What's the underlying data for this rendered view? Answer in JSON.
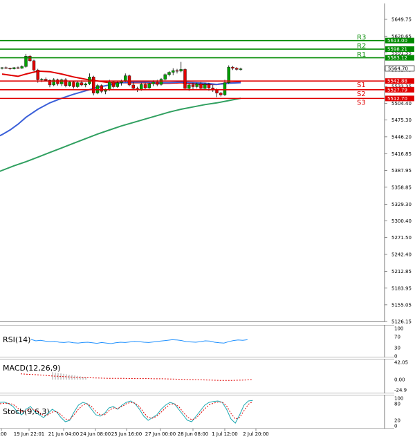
{
  "chart_data": {
    "type": "candlestick",
    "price_axis": {
      "ticks": [
        "5649.75",
        "5620.65",
        "5591.55",
        "5562.45",
        "5533.35",
        "5504.40",
        "5475.30",
        "5446.20",
        "5416.85",
        "5387.95",
        "5358.85",
        "5329.30",
        "5300.40",
        "5271.50",
        "5242.40",
        "5212.85",
        "5183.95",
        "5155.05",
        "5126.15"
      ],
      "range": [
        5126.15,
        5649.75
      ]
    },
    "time_axis": [
      "2:00",
      "19 Jun 22:01",
      "21 Jun 04:00",
      "24 Jun 08:00",
      "25 Jun 16:00",
      "27 Jun 00:00",
      "28 Jun 08:00",
      "1 Jul 12:00",
      "2 Jul 20:00"
    ],
    "levels": [
      {
        "name": "R3",
        "value": 5613.0,
        "label": "5613.00",
        "color": "#008a00"
      },
      {
        "name": "R2",
        "value": 5598.21,
        "label": "5598.21",
        "color": "#008a00"
      },
      {
        "name": "R1",
        "value": 5583.12,
        "label": "5583.12",
        "color": "#008a00"
      },
      {
        "name": "S1",
        "value": 5542.88,
        "label": "5542.88",
        "color": "#e00000"
      },
      {
        "name": "S2",
        "value": 5527.79,
        "label": "5527.79",
        "color": "#e00000"
      },
      {
        "name": "S3",
        "value": 5512.7,
        "label": "5512.70",
        "color": "#e00000"
      }
    ],
    "current_price": {
      "value": 5564.7,
      "label": "5564.70"
    },
    "candles": [
      [
        5565,
        5567,
        5563,
        5566
      ],
      [
        5566,
        5568,
        5564,
        5565
      ],
      [
        5565,
        5566,
        5562,
        5564
      ],
      [
        5564,
        5567,
        5563,
        5566
      ],
      [
        5566,
        5568,
        5564,
        5565
      ],
      [
        5565,
        5570,
        5564,
        5568
      ],
      [
        5568,
        5590,
        5566,
        5586
      ],
      [
        5586,
        5588,
        5576,
        5578
      ],
      [
        5578,
        5580,
        5560,
        5562
      ],
      [
        5562,
        5564,
        5540,
        5545
      ],
      [
        5545,
        5548,
        5541,
        5546
      ],
      [
        5546,
        5549,
        5542,
        5544
      ],
      [
        5544,
        5546,
        5532,
        5536
      ],
      [
        5536,
        5548,
        5534,
        5545
      ],
      [
        5545,
        5547,
        5535,
        5538
      ],
      [
        5538,
        5547,
        5534,
        5545
      ],
      [
        5545,
        5548,
        5532,
        5535
      ],
      [
        5535,
        5543,
        5533,
        5541
      ],
      [
        5541,
        5543,
        5530,
        5533
      ],
      [
        5533,
        5543,
        5531,
        5540
      ],
      [
        5540,
        5544,
        5534,
        5536
      ],
      [
        5536,
        5540,
        5532,
        5538
      ],
      [
        5538,
        5556,
        5536,
        5550
      ],
      [
        5550,
        5552,
        5518,
        5522
      ],
      [
        5522,
        5538,
        5520,
        5535
      ],
      [
        5535,
        5537,
        5522,
        5525
      ],
      [
        5525,
        5530,
        5520,
        5528
      ],
      [
        5528,
        5545,
        5526,
        5541
      ],
      [
        5541,
        5543,
        5530,
        5533
      ],
      [
        5533,
        5543,
        5531,
        5540
      ],
      [
        5540,
        5545,
        5535,
        5543
      ],
      [
        5543,
        5556,
        5541,
        5552
      ],
      [
        5552,
        5554,
        5534,
        5536
      ],
      [
        5536,
        5541,
        5527,
        5530
      ],
      [
        5530,
        5533,
        5524,
        5528
      ],
      [
        5528,
        5540,
        5526,
        5537
      ],
      [
        5537,
        5540,
        5527,
        5531
      ],
      [
        5531,
        5540,
        5529,
        5538
      ],
      [
        5538,
        5544,
        5534,
        5541
      ],
      [
        5541,
        5545,
        5534,
        5537
      ],
      [
        5537,
        5548,
        5535,
        5546
      ],
      [
        5546,
        5556,
        5544,
        5554
      ],
      [
        5554,
        5560,
        5551,
        5558
      ],
      [
        5558,
        5565,
        5553,
        5561
      ],
      [
        5561,
        5564,
        5556,
        5560
      ],
      [
        5560,
        5576,
        5558,
        5563
      ],
      [
        5563,
        5565,
        5528,
        5530
      ],
      [
        5530,
        5538,
        5526,
        5536
      ],
      [
        5536,
        5540,
        5528,
        5533
      ],
      [
        5533,
        5540,
        5530,
        5538
      ],
      [
        5538,
        5541,
        5527,
        5530
      ],
      [
        5530,
        5540,
        5528,
        5537
      ],
      [
        5537,
        5540,
        5526,
        5531
      ],
      [
        5531,
        5536,
        5524,
        5527
      ],
      [
        5527,
        5530,
        5515,
        5522
      ],
      [
        5522,
        5524,
        5516,
        5519
      ],
      [
        5519,
        5545,
        5517,
        5540
      ],
      [
        5540,
        5570,
        5538,
        5567
      ],
      [
        5567,
        5569,
        5562,
        5565
      ],
      [
        5565,
        5567,
        5561,
        5563
      ],
      [
        5563,
        5566,
        5561,
        5564
      ]
    ],
    "moving_averages": [
      {
        "color": "#e00000",
        "points": [
          [
            0,
            5555
          ],
          [
            2,
            5553
          ],
          [
            4,
            5551
          ],
          [
            6,
            5555
          ],
          [
            9,
            5560
          ],
          [
            12,
            5559
          ],
          [
            15,
            5555
          ],
          [
            18,
            5550
          ],
          [
            21,
            5546
          ],
          [
            24,
            5543
          ],
          [
            27,
            5540
          ],
          [
            30,
            5540
          ],
          [
            33,
            5540
          ],
          [
            36,
            5540
          ],
          [
            39,
            5539
          ],
          [
            42,
            5539
          ],
          [
            45,
            5540
          ],
          [
            48,
            5538
          ],
          [
            51,
            5537
          ],
          [
            54,
            5537
          ],
          [
            57,
            5540
          ],
          [
            60,
            5541
          ]
        ]
      },
      {
        "color": "#3a5fd9",
        "points": [
          [
            -3,
            5440
          ],
          [
            0,
            5450
          ],
          [
            2,
            5458
          ],
          [
            4,
            5468
          ],
          [
            6,
            5480
          ],
          [
            9,
            5494
          ],
          [
            12,
            5505
          ],
          [
            15,
            5513
          ],
          [
            18,
            5520
          ],
          [
            21,
            5526
          ],
          [
            24,
            5532
          ],
          [
            27,
            5536
          ],
          [
            30,
            5540
          ],
          [
            33,
            5541
          ],
          [
            36,
            5541
          ],
          [
            39,
            5540
          ],
          [
            42,
            5540
          ],
          [
            45,
            5541
          ],
          [
            48,
            5540
          ],
          [
            51,
            5539
          ],
          [
            54,
            5537
          ],
          [
            57,
            5539
          ],
          [
            60,
            5540
          ]
        ]
      },
      {
        "color": "#30a060",
        "points": [
          [
            -3,
            5380
          ],
          [
            0,
            5388
          ],
          [
            3,
            5396
          ],
          [
            6,
            5403
          ],
          [
            9,
            5411
          ],
          [
            12,
            5419
          ],
          [
            15,
            5427
          ],
          [
            18,
            5435
          ],
          [
            21,
            5443
          ],
          [
            24,
            5451
          ],
          [
            27,
            5458
          ],
          [
            30,
            5465
          ],
          [
            33,
            5471
          ],
          [
            36,
            5477
          ],
          [
            39,
            5483
          ],
          [
            42,
            5489
          ],
          [
            45,
            5494
          ],
          [
            48,
            5498
          ],
          [
            51,
            5502
          ],
          [
            54,
            5505
          ],
          [
            57,
            5509
          ],
          [
            60,
            5513
          ]
        ]
      }
    ],
    "rsi": {
      "label": "RSI(14)",
      "ticks": [
        "100",
        "70",
        "30",
        "0"
      ],
      "values": [
        60,
        55,
        57,
        54,
        52,
        53,
        50,
        49,
        51,
        48,
        47,
        49,
        50,
        48,
        46,
        49,
        47,
        45,
        48,
        50,
        49,
        51,
        53,
        52,
        50,
        49,
        51,
        53,
        55,
        57,
        59,
        58,
        56,
        52,
        51,
        50,
        52,
        55,
        54,
        50,
        48,
        47,
        52,
        56,
        58,
        57,
        59
      ]
    },
    "macd": {
      "label": "MACD(12,26,9)",
      "ticks": [
        "42.05",
        "0.00",
        "-24.9"
      ],
      "signal": [
        14,
        13,
        12,
        11,
        9,
        8,
        7,
        6,
        5,
        4.5,
        4,
        3.5,
        3,
        3,
        3,
        2.5,
        2.5,
        2.5,
        2,
        2,
        1.5,
        1,
        0.5,
        0,
        -0.5,
        -1,
        -1.5,
        -2,
        -2,
        -1.5,
        -1,
        0
      ],
      "hist_bars": [
        18,
        17,
        16,
        15,
        14,
        13,
        12,
        11,
        10,
        9,
        8,
        7,
        6
      ]
    },
    "stoch": {
      "label": "Stoch(9,6,3)",
      "ticks": [
        "100",
        "80",
        "20",
        "0"
      ],
      "k": [
        85,
        86,
        80,
        70,
        50,
        40,
        60,
        70,
        50,
        40,
        30,
        45,
        60,
        50,
        30,
        15,
        20,
        50,
        75,
        85,
        80,
        60,
        40,
        35,
        45,
        65,
        70,
        60,
        75,
        85,
        90,
        80,
        60,
        35,
        20,
        30,
        40,
        60,
        75,
        85,
        80,
        60,
        40,
        20,
        15,
        35,
        55,
        75,
        85,
        88,
        90,
        85,
        60,
        25,
        10,
        40,
        75,
        90,
        92
      ],
      "d": [
        80,
        82,
        81,
        78,
        65,
        50,
        55,
        62,
        58,
        48,
        38,
        40,
        50,
        52,
        40,
        25,
        22,
        40,
        60,
        75,
        80,
        70,
        52,
        40,
        40,
        55,
        65,
        63,
        70,
        80,
        85,
        82,
        70,
        48,
        30,
        28,
        35,
        50,
        65,
        78,
        80,
        70,
        50,
        32,
        22,
        28,
        45,
        62,
        76,
        82,
        86,
        86,
        72,
        45,
        25,
        30,
        55,
        78,
        88
      ]
    }
  }
}
